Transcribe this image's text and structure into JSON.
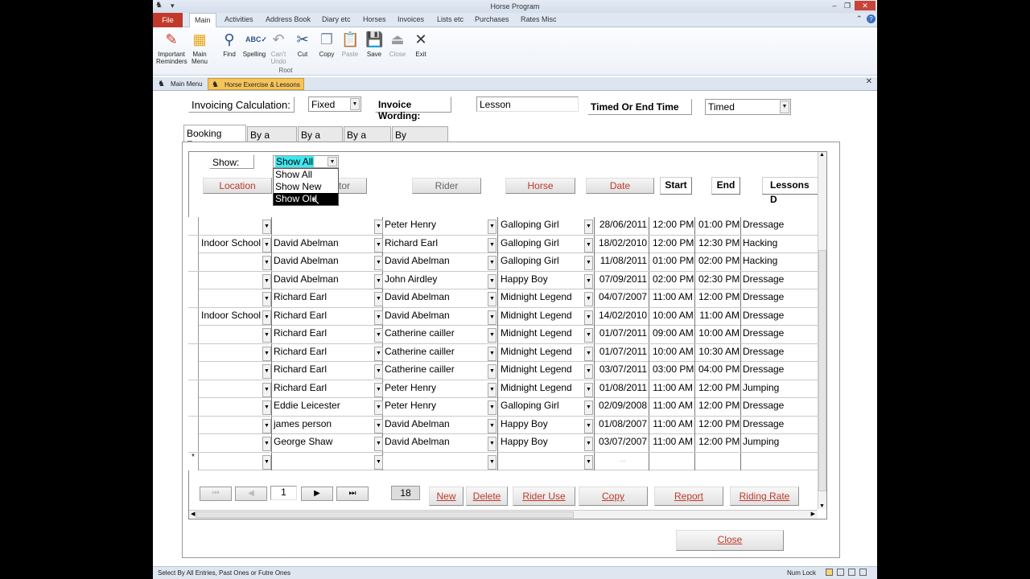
{
  "window": {
    "title": "Horse Program",
    "quick_access": "▾"
  },
  "ribbon_tabs": [
    "File",
    "Main",
    "Activities",
    "Address Book",
    "Diary etc",
    "Horses",
    "Invoices",
    "Lists etc",
    "Purchases",
    "Rates  Misc"
  ],
  "ribbon": {
    "buttons": [
      {
        "label": "Important Reminders",
        "icon": "pencil-icon"
      },
      {
        "label": "Main Menu",
        "icon": "grid-icon"
      },
      {
        "label": "Find",
        "icon": "binoculars-icon"
      },
      {
        "label": "Spelling",
        "icon": "spellcheck-icon"
      },
      {
        "label": "Can't Undo",
        "icon": "undo-icon"
      },
      {
        "label": "Cut",
        "icon": "scissors-icon"
      },
      {
        "label": "Copy",
        "icon": "copy-icon"
      },
      {
        "label": "Paste",
        "icon": "paste-icon"
      },
      {
        "label": "Save",
        "icon": "save-icon"
      },
      {
        "label": "Close",
        "icon": "close-doc-icon"
      },
      {
        "label": "Exit",
        "icon": "exit-icon"
      }
    ],
    "group_label": "Root"
  },
  "doc_tabs": [
    "Main Menu",
    "Horse Exercise & Lessons"
  ],
  "form": {
    "invoicing_label": "Invoicing Calculation:",
    "invoicing_value": "Fixed",
    "wording_label": "Invoice Wording:",
    "wording_value": "Lesson",
    "timed_label": "Timed Or End Time",
    "timed_value": "Timed",
    "tabs": [
      "Booking Form",
      "By a Horse",
      "By a Date",
      "By a Rider",
      "By Instructor"
    ],
    "show_label": "Show:",
    "show_value": "Show All",
    "show_options": [
      "Show All",
      "Show New",
      "Show Old"
    ],
    "headers": {
      "location": "Location",
      "instructor": "ctor",
      "rider": "Rider",
      "horse": "Horse",
      "date": "Date",
      "start": "Start",
      "end": "End",
      "lessons": "Lessons D"
    }
  },
  "rows": [
    {
      "location": "",
      "instructor": "",
      "rider": "Peter Henry",
      "horse": "Galloping Girl",
      "date": "28/06/2011",
      "start": "12:00 PM",
      "end": "01:00 PM",
      "lesson": "Dressage"
    },
    {
      "location": "Indoor School",
      "instructor": "David Abelman",
      "rider": "Richard Earl",
      "horse": "Galloping Girl",
      "date": "18/02/2010",
      "start": "12:00 PM",
      "end": "12:30 PM",
      "lesson": "Hacking"
    },
    {
      "location": "",
      "instructor": "David Abelman",
      "rider": "David Abelman",
      "horse": "Galloping Girl",
      "date": "11/08/2011",
      "start": "01:00 PM",
      "end": "02:00 PM",
      "lesson": "Hacking"
    },
    {
      "location": "",
      "instructor": "David Abelman",
      "rider": "John Airdley",
      "horse": "Happy Boy",
      "date": "07/09/2011",
      "start": "02:00 PM",
      "end": "02:30 PM",
      "lesson": "Dressage"
    },
    {
      "location": "",
      "instructor": "Richard Earl",
      "rider": "David Abelman",
      "horse": "Midnight Legend",
      "date": "04/07/2007",
      "start": "11:00 AM",
      "end": "12:00 PM",
      "lesson": "Dressage"
    },
    {
      "location": "Indoor School",
      "instructor": "Richard Earl",
      "rider": "David Abelman",
      "horse": "Midnight Legend",
      "date": "14/02/2010",
      "start": "10:00 AM",
      "end": "11:00 AM",
      "lesson": "Dressage"
    },
    {
      "location": "",
      "instructor": "Richard Earl",
      "rider": "Catherine cailler",
      "horse": "Midnight Legend",
      "date": "01/07/2011",
      "start": "09:00 AM",
      "end": "10:00 AM",
      "lesson": "Dressage"
    },
    {
      "location": "",
      "instructor": "Richard Earl",
      "rider": "Catherine cailler",
      "horse": "Midnight Legend",
      "date": "01/07/2011",
      "start": "10:00 AM",
      "end": "10:30 AM",
      "lesson": "Dressage"
    },
    {
      "location": "",
      "instructor": "Richard Earl",
      "rider": "Catherine cailler",
      "horse": "Midnight Legend",
      "date": "03/07/2011",
      "start": "03:00 PM",
      "end": "04:00 PM",
      "lesson": "Dressage"
    },
    {
      "location": "",
      "instructor": "Richard Earl",
      "rider": "Peter Henry",
      "horse": "Midnight Legend",
      "date": "01/08/2011",
      "start": "11:00 AM",
      "end": "12:00 PM",
      "lesson": "Jumping"
    },
    {
      "location": "",
      "instructor": "Eddie Leicester",
      "rider": "Peter Henry",
      "horse": "Galloping Girl",
      "date": "02/09/2008",
      "start": "11:00 AM",
      "end": "12:00 PM",
      "lesson": "Dressage"
    },
    {
      "location": "",
      "instructor": "james person",
      "rider": "David Abelman",
      "horse": "Happy Boy",
      "date": "01/08/2007",
      "start": "11:00 AM",
      "end": "12:00 PM",
      "lesson": "Dressage"
    },
    {
      "location": "",
      "instructor": "George Shaw",
      "rider": "David Abelman",
      "horse": "Happy Boy",
      "date": "03/07/2007",
      "start": "11:00 AM",
      "end": "12:00 PM",
      "lesson": "Jumping"
    }
  ],
  "new_row_marker": "*",
  "new_row_date": "...",
  "nav": {
    "first": "⏮",
    "prev": "◀",
    "page": "1",
    "next": "▶",
    "last": "⏭",
    "count": "18"
  },
  "actions": [
    "New",
    "Delete",
    "Rider Use",
    "Copy",
    "Report",
    "Riding  Rate"
  ],
  "close_label": "Close",
  "status": {
    "text": "Select By All Entries, Past Ones or Futre Ones",
    "numlock": "Num Lock"
  }
}
